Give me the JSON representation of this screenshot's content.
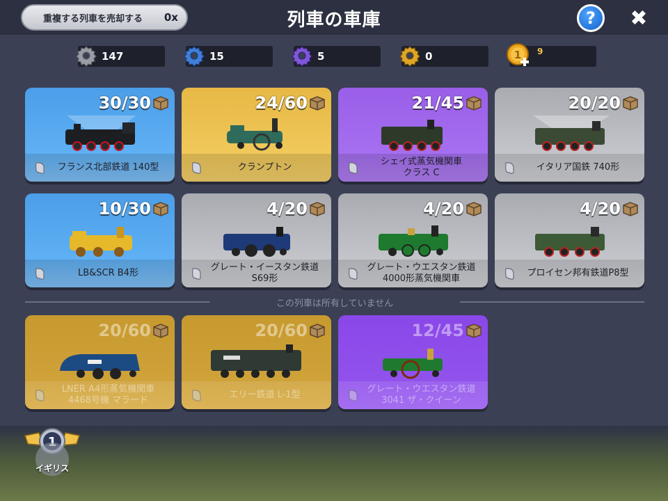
{
  "header": {
    "title": "列車の車庫",
    "sell_duplicates_label": "重複する列車を売却する",
    "sell_count": "0x",
    "help_label": "?",
    "close_label": "✖"
  },
  "resources": [
    {
      "name": "grey-gear",
      "value": "147",
      "color": "#9a9ca6"
    },
    {
      "name": "blue-gear",
      "value": "15",
      "color": "#3f7fd8"
    },
    {
      "name": "purple-gear",
      "value": "5",
      "color": "#7e58d8"
    },
    {
      "name": "gold-gear",
      "value": "0",
      "color": "#e0a626"
    },
    {
      "name": "gold-coin",
      "value": "1",
      "badge": "9",
      "color": "#f0a820"
    }
  ],
  "owned_trains": [
    {
      "count": "30/30",
      "name": "フランス北部鉄道 140型",
      "rarity": "blue"
    },
    {
      "count": "24/60",
      "name": "クランプトン",
      "rarity": "gold"
    },
    {
      "count": "21/45",
      "name": "シェイ式蒸気機関車",
      "name2": "クラス C",
      "rarity": "purple"
    },
    {
      "count": "20/20",
      "name": "イタリア国鉄 740形",
      "rarity": "grey"
    },
    {
      "count": "10/30",
      "name": "LB&SCR B4形",
      "rarity": "blue"
    },
    {
      "count": "4/20",
      "name": "グレート・イースタン鉄道",
      "name2": "S69形",
      "rarity": "grey"
    },
    {
      "count": "4/20",
      "name": "グレート・ウエスタン鉄道",
      "name2": "4000形蒸気機関車",
      "rarity": "grey"
    },
    {
      "count": "4/20",
      "name": "プロイセン邦有鉄道P8型",
      "rarity": "grey"
    }
  ],
  "divider_text": "この列車は所有していません",
  "unowned_trains": [
    {
      "count": "20/60",
      "name": "LNER A4形蒸気機関車",
      "name2": "4468号機 マラード",
      "rarity": "gold"
    },
    {
      "count": "20/60",
      "name": "エリー鉄道 L-1型",
      "rarity": "gold"
    },
    {
      "count": "12/45",
      "name": "グレート・ウエスタン鉄道",
      "name2": "3041 ザ・クイーン",
      "rarity": "purple"
    }
  ],
  "region": {
    "level": "1",
    "label": "イギリス"
  }
}
